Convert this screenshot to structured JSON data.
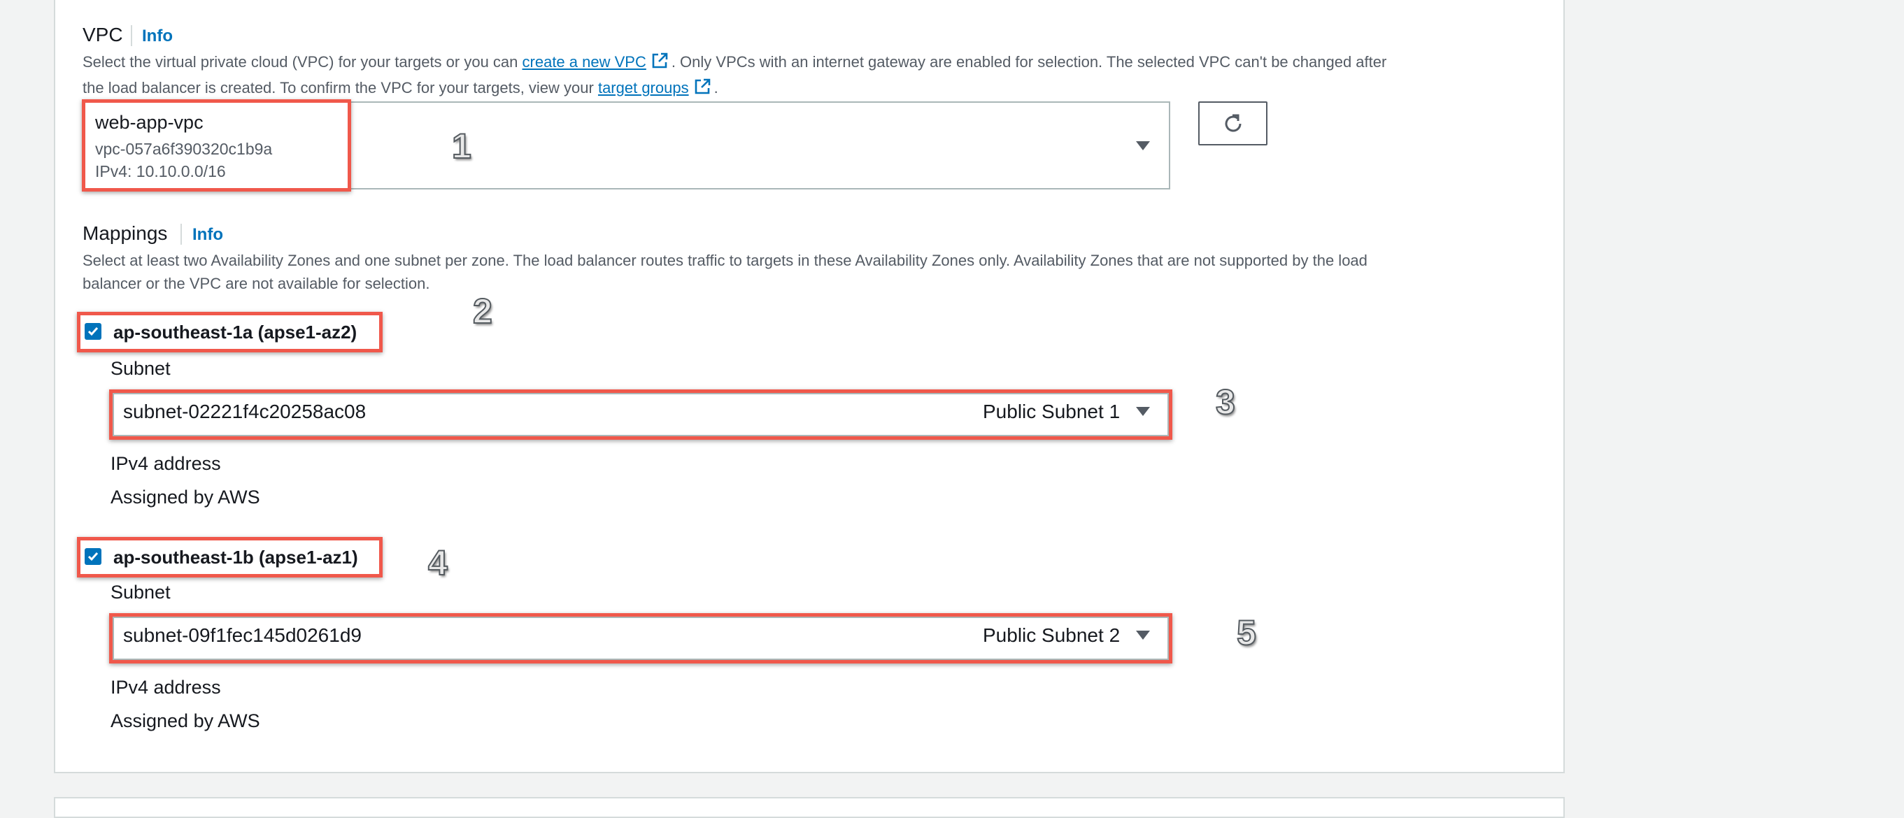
{
  "vpc": {
    "title": "VPC",
    "info_label": "Info",
    "desc_part1": "Select the virtual private cloud (VPC) for your targets or you can ",
    "create_link": "create a new VPC",
    "desc_part2": ". Only VPCs with an internet gateway are enabled for selection. The selected VPC can't be changed after",
    "desc_line2_part1": "the load balancer is created. To confirm the VPC for your targets, view your ",
    "target_groups_link": "target groups",
    "desc_line2_part2": ".",
    "selected_name": "web-app-vpc",
    "selected_id": "vpc-057a6f390320c1b9a",
    "selected_cidr": "IPv4: 10.10.0.0/16"
  },
  "mappings": {
    "title": "Mappings",
    "info_label": "Info",
    "desc_line1": "Select at least two Availability Zones and one subnet per zone. The load balancer routes traffic to targets in these Availability Zones only. Availability Zones that are not supported by the load",
    "desc_line2": "balancer or the VPC are not available for selection.",
    "zones": [
      {
        "label": "ap-southeast-1a (apse1-az2)",
        "checked": true,
        "subnet_label": "Subnet",
        "subnet_id": "subnet-02221f4c20258ac08",
        "subnet_name": "Public Subnet 1",
        "ipv4_label": "IPv4 address",
        "ipv4_value": "Assigned by AWS"
      },
      {
        "label": "ap-southeast-1b (apse1-az1)",
        "checked": true,
        "subnet_label": "Subnet",
        "subnet_id": "subnet-09f1fec145d0261d9",
        "subnet_name": "Public Subnet 2",
        "ipv4_label": "IPv4 address",
        "ipv4_value": "Assigned by AWS"
      }
    ]
  },
  "markers": [
    "1",
    "2",
    "3",
    "4",
    "5"
  ],
  "colors": {
    "link": "#0073bb",
    "highlight": "#f0584b",
    "checkbox": "#0073bb"
  }
}
